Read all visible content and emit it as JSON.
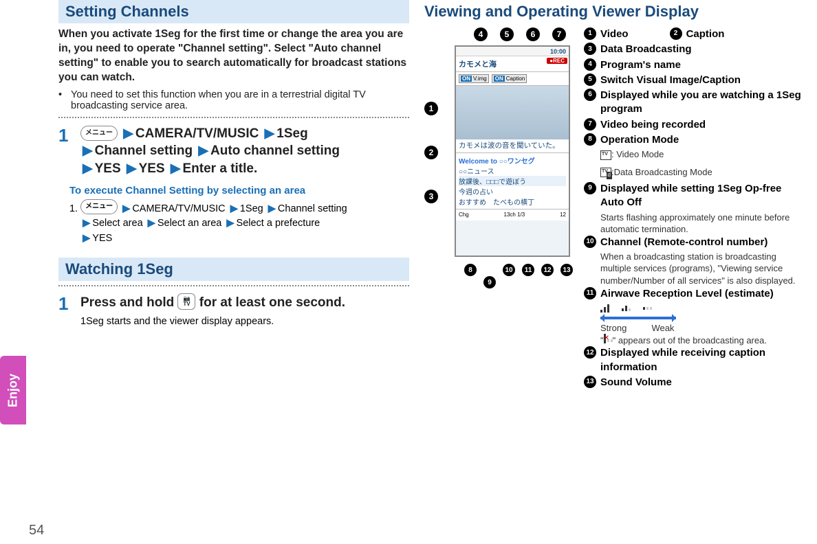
{
  "page_number": "54",
  "side_tab": "Enjoy",
  "left": {
    "section1_title": "Setting Channels",
    "intro": "When you activate 1Seg for the first time or change the area you are in, you need to operate \"Channel setting\". Select \"Auto channel setting\" to enable you to search automatically for broadcast stations you can watch.",
    "bullet1": "You need to set this function when you are in a terrestrial digital TV broadcasting service area.",
    "step1_num": "1",
    "menu_btn": "メニュー",
    "path": {
      "n1": "CAMERA/TV/MUSIC",
      "n2": "1Seg",
      "n3": "Channel setting",
      "n4": "Auto channel setting",
      "n5": "YES",
      "n6": "YES",
      "n7": "Enter a title."
    },
    "exec_title": "To execute Channel Setting by selecting an area",
    "exec_step_num": "1.",
    "exec_path": {
      "e1": "CAMERA/TV/MUSIC",
      "e2": "1Seg",
      "e3": "Channel setting",
      "e4": "Select area",
      "e5": "Select an area",
      "e6": "Select a prefecture",
      "e7": "YES"
    },
    "section2_title": "Watching 1Seg",
    "w_step_num": "1",
    "w_step_pre": "Press and hold ",
    "w_step_post": " for at least one second.",
    "tvbtn_top": "📷",
    "tvbtn_bottom": "TV",
    "w_result": "1Seg starts and the viewer display appears."
  },
  "right": {
    "title": "Viewing and Operating Viewer Display",
    "phone": {
      "status_right": "10:00",
      "rec": "●REC",
      "title_bar": "カモメと海",
      "tab1_on": "ON",
      "tab1": "V.img",
      "tab2_on": "ON",
      "tab2": "Caption",
      "caption_text": "カモメは波の音を聞いていた。",
      "db_welcome": "Welcome to ○○ワンセグ",
      "db_line2": "○○ニュース",
      "db_line3": "放課後、□□□で遊ぼう",
      "db_line4": "今週の占い",
      "db_line5": "おすすめ　たべもの横丁",
      "bottom_left": "Chg",
      "bottom_mid": "13ch 1/3",
      "bottom_right": "12"
    },
    "legend": {
      "i1": "Video",
      "i2": "Caption",
      "i3": "Data Broadcasting",
      "i4": "Program's name",
      "i5": "Switch Visual Image/Caption",
      "i6": "Displayed while you are watching a 1Seg program",
      "i7": "Video being recorded",
      "i8": "Operation Mode",
      "i8a": ": Video Mode",
      "i8b": ":Data Broadcasting Mode",
      "i9": "Displayed while setting 1Seg Op-free Auto Off",
      "i9s": "Starts flashing approximately one minute before automatic termination.",
      "i10": "Channel (Remote-control number)",
      "i10s": "When a broadcasting station is broadcasting multiple services (programs), \"Viewing service number/Number of all services\" is also displayed.",
      "i11": "Airwave Reception Level (estimate)",
      "i11_strong": "Strong",
      "i11_weak": "Weak",
      "i11_out_pre": "\"",
      "i11_out_post": "\" appears out of the broadcasting area.",
      "i12": "Displayed while receiving caption information",
      "i13": "Sound Volume"
    }
  }
}
